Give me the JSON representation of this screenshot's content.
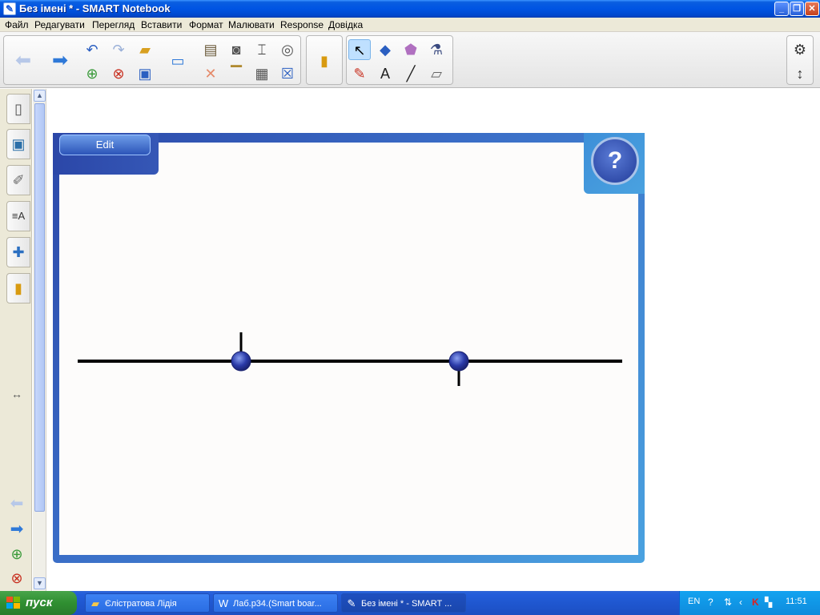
{
  "window": {
    "title": "Без імені * - SMART Notebook",
    "app_icon": "smart-notebook-icon",
    "controls": [
      "minimize",
      "maximize",
      "close"
    ]
  },
  "menu": {
    "items": [
      "Файл",
      "Редагувати",
      "Перегляд",
      "Вставити",
      "Формат",
      "Малювати",
      "Response",
      "Довідка"
    ]
  },
  "toolbar": {
    "nav": [
      "back-arrow-icon",
      "forward-arrow-icon"
    ],
    "file": [
      "undo-icon",
      "redo-icon",
      "open-folder-icon",
      "add-page-icon",
      "delete-page-icon",
      "save-icon"
    ],
    "display": [
      "screen-shade-icon"
    ],
    "edit": [
      "paste-icon",
      "screen-capture-icon",
      "table-icon",
      "compass-icon",
      "delete-icon",
      "projector-icon",
      "insert-table-icon",
      "close-box-icon"
    ],
    "response": [
      "response-icon"
    ],
    "tools": [
      "select-arrow-icon",
      "shapes-icon",
      "magic-pen-icon",
      "fill-icon",
      "pens-icon",
      "text-icon",
      "line-icon",
      "eraser-icon"
    ],
    "side": [
      "settings-gear-icon",
      "move-toolbar-icon"
    ]
  },
  "sidebar": {
    "tabs": [
      "page-sorter-icon",
      "gallery-icon",
      "attachments-icon",
      "properties-icon",
      "addons-icon",
      "response-tab-icon"
    ],
    "bottom": [
      "expand-arrows-icon",
      "back-arrow-small-icon",
      "forward-arrow-small-icon",
      "add-page-small-icon",
      "delete-page-small-icon"
    ]
  },
  "widget": {
    "edit_label": "Edit",
    "help_label": "?",
    "colors": {
      "frame_dark": "#2b47a8",
      "frame_light": "#4aa2e0",
      "line": "#000000",
      "marker": "#2a3aa8"
    },
    "markers": [
      {
        "position": 0.3,
        "tick": "up"
      },
      {
        "position": 0.7,
        "tick": "down"
      }
    ]
  },
  "taskbar": {
    "start_label": "пуск",
    "tasks": [
      {
        "label": "Єлістратова Лідія",
        "icon": "folder-icon",
        "active": false
      },
      {
        "label": "Лаб.р34.(Smart boar...",
        "icon": "word-doc-icon",
        "active": false
      },
      {
        "label": "Без імені * - SMART ...",
        "icon": "smart-notebook-icon",
        "active": true
      }
    ],
    "tray": {
      "lang": "EN",
      "clock": "11:51"
    }
  }
}
